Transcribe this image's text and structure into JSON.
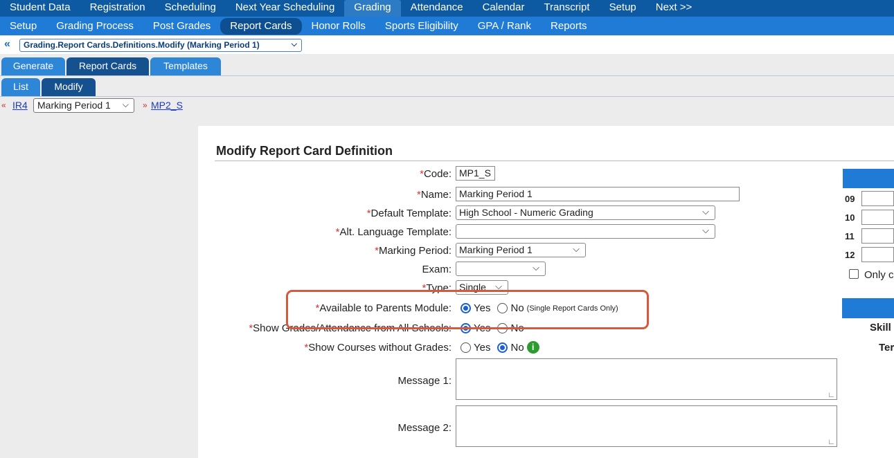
{
  "nav_primary": [
    "Student Data",
    "Registration",
    "Scheduling",
    "Next Year Scheduling",
    "Grading",
    "Attendance",
    "Calendar",
    "Transcript",
    "Setup",
    "Next >>"
  ],
  "nav_primary_active": "Grading",
  "nav_secondary": [
    "Setup",
    "Grading Process",
    "Post Grades",
    "Report Cards",
    "Honor Rolls",
    "Sports Eligibility",
    "GPA / Rank",
    "Reports"
  ],
  "nav_secondary_active": "Report Cards",
  "breadcrumb": {
    "back_icon": "«",
    "path": "Grading.Report Cards.Definitions.Modify (Marking Period 1)"
  },
  "tabs": [
    "Generate",
    "Report Cards",
    "Templates"
  ],
  "subtabs": [
    "List",
    "Modify"
  ],
  "record_nav": {
    "prev_marker": "«",
    "prev_link": "IR4",
    "current": "Marking Period 1",
    "next_marker": "»",
    "next_link": "MP2_S"
  },
  "form": {
    "title": "Modify Report Card Definition",
    "code": {
      "label": "Code:",
      "value": "MP1_S"
    },
    "name": {
      "label": "Name:",
      "value": "Marking Period 1"
    },
    "default_template": {
      "label": "Default Template:",
      "value": "High School - Numeric Grading"
    },
    "alt_language_template": {
      "label": "Alt. Language Template:",
      "value": ""
    },
    "marking_period": {
      "label": "Marking Period:",
      "value": "Marking Period 1"
    },
    "exam": {
      "label": "Exam:",
      "value": ""
    },
    "type": {
      "label": "Type:",
      "value": "Single"
    },
    "available_to_parents": {
      "label": "Available to Parents Module:",
      "yes": "Yes",
      "no": "No",
      "selected": "Yes",
      "note": "(Single Report Cards Only)"
    },
    "show_grades_all_schools": {
      "label": "Show Grades/Attendance from All Schools:",
      "yes": "Yes",
      "no": "No",
      "selected": "Yes"
    },
    "show_courses_without_grades": {
      "label": "Show Courses without Grades:",
      "yes": "Yes",
      "no": "No",
      "selected": "No"
    },
    "message1": {
      "label": "Message 1:",
      "value": ""
    },
    "message2": {
      "label": "Message 2:",
      "value": ""
    },
    "required_marker": "*"
  },
  "side_panel": {
    "grades": [
      "09",
      "10",
      "11",
      "12"
    ],
    "only_label": "Only c",
    "skill_label": "Skill",
    "ter_label": "Ter"
  },
  "colors": {
    "nav_primary": "#0d5aa3",
    "nav_secondary": "#1f7bd6",
    "highlight": "#d9573c",
    "info": "#2d9c2f"
  }
}
